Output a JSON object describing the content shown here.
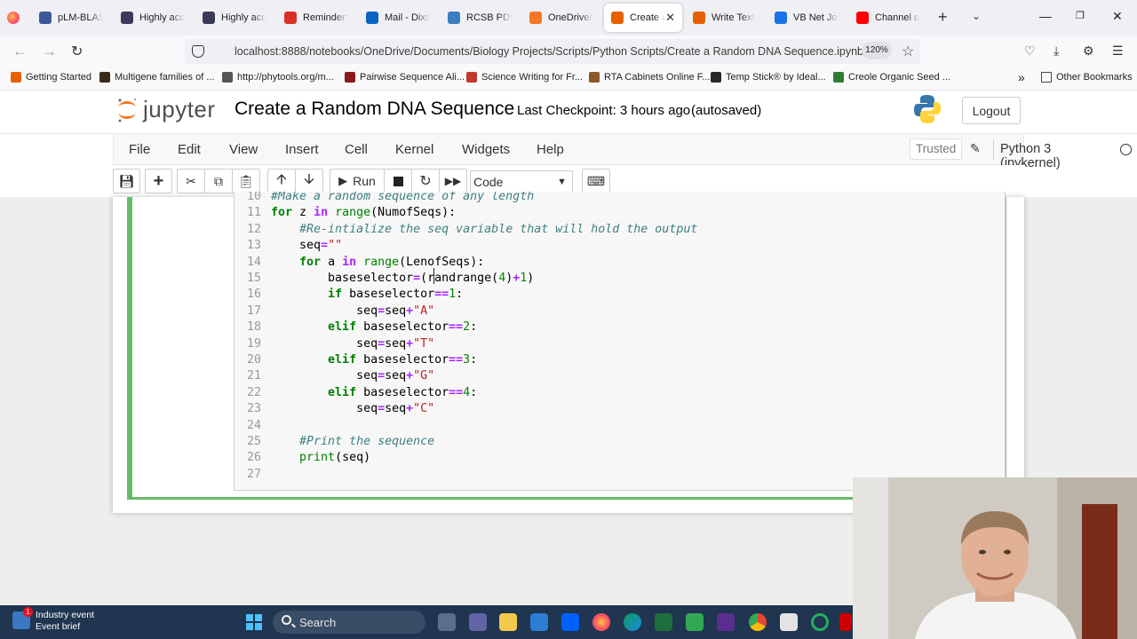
{
  "browser": {
    "tabs": [
      {
        "label": "pLM-BLAST",
        "icon": "tool-icon",
        "color": "#3b5998"
      },
      {
        "label": "Highly accu",
        "icon": "bookmark-icon",
        "color": "#3a3a5a"
      },
      {
        "label": "Highly accu",
        "icon": "bookmark-icon",
        "color": "#3a3a5a"
      },
      {
        "label": "Reminder: \\",
        "icon": "gmail-icon",
        "color": "#d93025"
      },
      {
        "label": "Mail - Dixs",
        "icon": "outlook-icon",
        "color": "#0a64c8"
      },
      {
        "label": "RCSB PDB",
        "icon": "rcsb-icon",
        "color": "#3a7ebf"
      },
      {
        "label": "OneDrive/D",
        "icon": "jupyter-icon",
        "color": "#f37726"
      },
      {
        "label": "Create a",
        "icon": "pen-icon",
        "color": "#e66000"
      },
      {
        "label": "Write Text",
        "icon": "pen-icon",
        "color": "#e66000"
      },
      {
        "label": "VB Net Job",
        "icon": "info-icon",
        "color": "#1a73e8"
      },
      {
        "label": "Channel co",
        "icon": "youtube-icon",
        "color": "#ff0000"
      }
    ],
    "active_tab_index": 7,
    "url": "localhost:8888/notebooks/OneDrive/Documents/Biology Projects/Scripts/Python Scripts/Create a Random DNA Sequence.ipynb",
    "zoom": "120%",
    "bookmarks": [
      {
        "label": "Getting Started",
        "color": "#e66000"
      },
      {
        "label": "Multigene families of ...",
        "color": "#3a2a1a"
      },
      {
        "label": "http://phytools.org/m...",
        "color": "#555555"
      },
      {
        "label": "Pairwise Sequence Ali...",
        "color": "#8b1a1a"
      },
      {
        "label": "Science Writing for Fr...",
        "color": "#c0392b"
      },
      {
        "label": "RTA Cabinets Online F...",
        "color": "#8a5a2a"
      },
      {
        "label": "Temp Stick® by Ideal...",
        "color": "#2a2a2a"
      },
      {
        "label": "Creole Organic Seed ...",
        "color": "#2e7d32"
      }
    ],
    "other_bookmarks": "Other Bookmarks"
  },
  "jupyter": {
    "logo_text": "jupyter",
    "notebook_title": "Create a Random DNA Sequence",
    "checkpoint": "Last Checkpoint: 3 hours ago",
    "autosave": "(autosaved)",
    "logout": "Logout",
    "menus": [
      "File",
      "Edit",
      "View",
      "Insert",
      "Cell",
      "Kernel",
      "Widgets",
      "Help"
    ],
    "trusted": "Trusted",
    "kernel": "Python 3 (ipykernel)",
    "run_label": "Run",
    "cell_type": "Code"
  },
  "code": {
    "lines": [
      {
        "n": "10",
        "html": "<span class=\"c\">#Make a random sequence of any length</span>"
      },
      {
        "n": "11",
        "html": "<span class=\"k\">for</span> z <span class=\"o\">in</span> <span class=\"b\">range</span>(NumofSeqs):"
      },
      {
        "n": "12",
        "html": "    <span class=\"c\">#Re-intialize the seq variable that will hold the output</span>"
      },
      {
        "n": "13",
        "html": "    seq<span class=\"o\">=</span><span class=\"s\">\"\"</span>"
      },
      {
        "n": "14",
        "html": "    <span class=\"k\">for</span> a <span class=\"o\">in</span> <span class=\"b\">range</span>(LenofSeqs):"
      },
      {
        "n": "15",
        "html": "        baseselector<span class=\"o\">=</span>(randrange(<span class=\"n\">4</span>)<span class=\"o\">+</span><span class=\"n\">1</span>)"
      },
      {
        "n": "16",
        "html": "        <span class=\"k\">if</span> baseselector<span class=\"o\">==</span><span class=\"n\">1</span>:"
      },
      {
        "n": "17",
        "html": "            seq<span class=\"o\">=</span>seq<span class=\"o\">+</span><span class=\"s\">\"A\"</span>"
      },
      {
        "n": "18",
        "html": "        <span class=\"k\">elif</span> baseselector<span class=\"o\">==</span><span class=\"n\">2</span>:"
      },
      {
        "n": "19",
        "html": "            seq<span class=\"o\">=</span>seq<span class=\"o\">+</span><span class=\"s\">\"T\"</span>"
      },
      {
        "n": "20",
        "html": "        <span class=\"k\">elif</span> baseselector<span class=\"o\">==</span><span class=\"n\">3</span>:"
      },
      {
        "n": "21",
        "html": "            seq<span class=\"o\">=</span>seq<span class=\"o\">+</span><span class=\"s\">\"G\"</span>"
      },
      {
        "n": "22",
        "html": "        <span class=\"k\">elif</span> baseselector<span class=\"o\">==</span><span class=\"n\">4</span>:"
      },
      {
        "n": "23",
        "html": "            seq<span class=\"o\">=</span>seq<span class=\"o\">+</span><span class=\"s\">\"C\"</span>"
      },
      {
        "n": "24",
        "html": ""
      },
      {
        "n": "25",
        "html": "    <span class=\"c\">#Print the sequence</span>"
      },
      {
        "n": "26",
        "html": "    <span class=\"b\">print</span>(seq)"
      },
      {
        "n": "27",
        "html": ""
      }
    ]
  },
  "taskbar": {
    "notification_title": "Industry event",
    "notification_sub": "Event brief",
    "notification_count": "1",
    "search": "Search"
  },
  "colors": {
    "cell_selected": "#66bb6a",
    "taskbar": "#1f3550"
  }
}
